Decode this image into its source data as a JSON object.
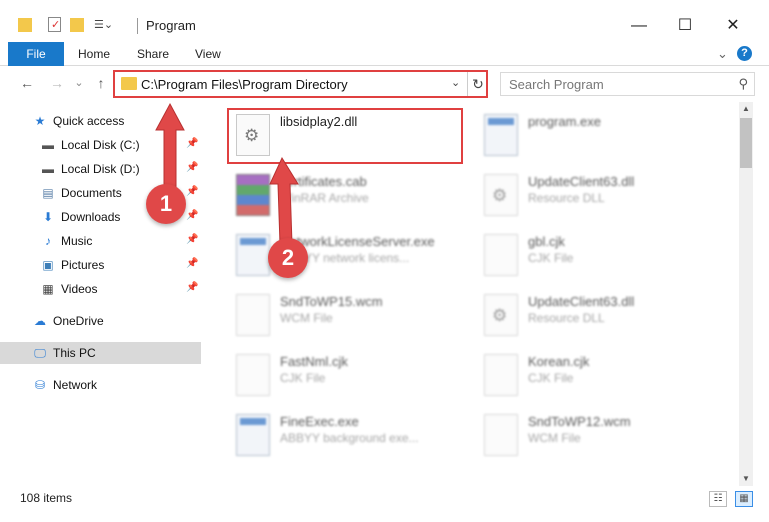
{
  "titlebar": {
    "title": "Program",
    "minimize_glyph": "—",
    "maximize_glyph": "☐",
    "close_glyph": "✕"
  },
  "ribbon": {
    "tabs": [
      "File",
      "Home",
      "Share",
      "View"
    ],
    "expand_glyph": "⌄",
    "help_glyph": "?"
  },
  "address_bar": {
    "path": "C:\\Program Files\\Program Directory",
    "caret_glyph": "⌄",
    "refresh_glyph": "↻"
  },
  "nav_buttons": {
    "back": "←",
    "forward": "→",
    "recent": "⌄",
    "up": "↑"
  },
  "search": {
    "placeholder": "Search Program",
    "icon_glyph": "⚲"
  },
  "navpane": {
    "items": [
      {
        "label": "Quick access",
        "icon": "star-icon",
        "glyph": "★",
        "color": "#2a7bd4",
        "pinned": false
      },
      {
        "label": "Local Disk (C:)",
        "icon": "drive-icon",
        "glyph": "▬",
        "color": "#555555",
        "pinned": true
      },
      {
        "label": "Local Disk (D:)",
        "icon": "drive-icon",
        "glyph": "▬",
        "color": "#555555",
        "pinned": true
      },
      {
        "label": "Documents",
        "icon": "documents-icon",
        "glyph": "▤",
        "color": "#5a7fa8",
        "pinned": true
      },
      {
        "label": "Downloads",
        "icon": "download-icon",
        "glyph": "⬇",
        "color": "#2a7bd4",
        "pinned": true
      },
      {
        "label": "Music",
        "icon": "music-icon",
        "glyph": "♪",
        "color": "#2a7bd4",
        "pinned": true
      },
      {
        "label": "Pictures",
        "icon": "pictures-icon",
        "glyph": "▣",
        "color": "#3e7fb8",
        "pinned": true
      },
      {
        "label": "Videos",
        "icon": "videos-icon",
        "glyph": "▦",
        "color": "#444444",
        "pinned": true
      },
      {
        "label": "OneDrive",
        "icon": "cloud-icon",
        "glyph": "☁",
        "color": "#2a7bd4",
        "pinned": false
      },
      {
        "label": "This PC",
        "icon": "computer-icon",
        "glyph": "🖵",
        "color": "#2a7bd4",
        "pinned": false
      },
      {
        "label": "Network",
        "icon": "network-icon",
        "glyph": "⛁",
        "color": "#2a7bd4",
        "pinned": false
      }
    ],
    "pin_glyph": "📌"
  },
  "files": [
    {
      "name": "libsidplay2.dll",
      "type": "",
      "icon": "dll-icon"
    },
    {
      "name": "program.exe",
      "type": "",
      "icon": "app-icon"
    },
    {
      "name": "certificates.cab",
      "type": "WinRAR Archive",
      "icon": "rar-icon"
    },
    {
      "name": "UpdateClient63.dll",
      "type": "Resource DLL",
      "icon": "dll-icon"
    },
    {
      "name": "NetworkLicenseServer.exe",
      "type": "ABBYY network licens...",
      "icon": "app-icon"
    },
    {
      "name": "gbl.cjk",
      "type": "CJK File",
      "icon": "file-icon"
    },
    {
      "name": "SndToWP15.wcm",
      "type": "WCM File",
      "icon": "file-icon"
    },
    {
      "name": "UpdateClient63.dll",
      "type": "Resource DLL",
      "icon": "dll-icon"
    },
    {
      "name": "FastNml.cjk",
      "type": "CJK File",
      "icon": "file-icon"
    },
    {
      "name": "Korean.cjk",
      "type": "CJK File",
      "icon": "file-icon"
    },
    {
      "name": "FineExec.exe",
      "type": "ABBYY background exe...",
      "icon": "app-icon"
    },
    {
      "name": "SndToWP12.wcm",
      "type": "WCM File",
      "icon": "file-icon"
    }
  ],
  "status": {
    "item_count": "108 items"
  },
  "annotations": {
    "step1": "1",
    "step2": "2",
    "color": "#e04848"
  }
}
